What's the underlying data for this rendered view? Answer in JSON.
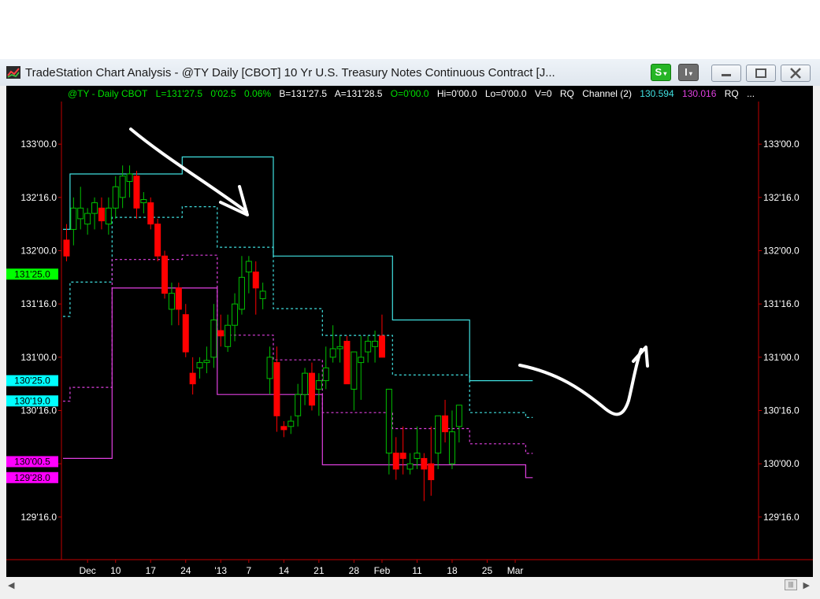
{
  "window": {
    "title": "TradeStation Chart Analysis - @TY Daily [CBOT] 10 Yr U.S. Treasury Notes Continuous Contract [J...",
    "s_button_label": "S",
    "i_button_label": "I"
  },
  "status": {
    "symbol": "@TY - Daily  CBOT",
    "last": "L=131'27.5",
    "change": "0'02.5",
    "pct": "0.06%",
    "bid": "B=131'27.5",
    "ask": "A=131'28.5",
    "open": "O=0'00.0",
    "high": "Hi=0'00.0",
    "low": "Lo=0'00.0",
    "volume": "V=0",
    "rq1": "RQ",
    "indicator": "Channel (2)",
    "ch_upper": "130.594",
    "ch_lower": "130.016",
    "rq2": "RQ",
    "more": "..."
  },
  "colors": {
    "background": "#000000",
    "up_candle": "#00c000",
    "down_candle": "#ff0000",
    "upper_channel": "#40e0e0",
    "lower_channel": "#e040e0",
    "axis": "#c00000",
    "last_price_marker": "#00ff00",
    "cyan_marker": "#00ffff",
    "magenta_marker": "#ff00ff"
  },
  "chart_data": {
    "type": "candlestick",
    "y_axis_labels": [
      "133'00.0",
      "132'16.0",
      "132'00.0",
      "131'16.0",
      "131'00.0",
      "130'16.0",
      "130'00.0",
      "129'16.0"
    ],
    "y_axis_values": [
      133.0,
      132.5,
      132.0,
      131.5,
      131.0,
      130.5,
      130.0,
      129.5
    ],
    "ylim": [
      129.1,
      133.4
    ],
    "x_axis_labels": [
      {
        "label": "Dec",
        "bar": 3.5
      },
      {
        "label": "10",
        "bar": 7.5
      },
      {
        "label": "17",
        "bar": 12.5
      },
      {
        "label": "24",
        "bar": 17.5
      },
      {
        "label": "'13",
        "bar": 22.5
      },
      {
        "label": "7",
        "bar": 26.5
      },
      {
        "label": "14",
        "bar": 31.5
      },
      {
        "label": "21",
        "bar": 36.5
      },
      {
        "label": "28",
        "bar": 41.5
      },
      {
        "label": "Feb",
        "bar": 45.5
      },
      {
        "label": "11",
        "bar": 50.5
      },
      {
        "label": "18",
        "bar": 55.5
      },
      {
        "label": "25",
        "bar": 60.5
      },
      {
        "label": "Mar",
        "bar": 64.5
      }
    ],
    "price_markers": [
      {
        "label": "131'25.0",
        "value": 131.78,
        "color": "#00ff00"
      },
      {
        "label": "130'25.0",
        "value": 130.78,
        "color": "#00ffff"
      },
      {
        "label": "130'19.0",
        "value": 130.59,
        "color": "#00ffff"
      },
      {
        "label": "130'00.5",
        "value": 130.02,
        "color": "#ff00ff"
      },
      {
        "label": "129'28.0",
        "value": 129.87,
        "color": "#ff00ff"
      }
    ],
    "candles": [
      [
        132.1,
        132.25,
        131.9,
        131.95
      ],
      [
        132.2,
        132.5,
        132.05,
        132.4
      ],
      [
        132.3,
        132.6,
        132.2,
        132.4
      ],
      [
        132.25,
        132.4,
        132.15,
        132.35
      ],
      [
        132.35,
        132.5,
        132.2,
        132.45
      ],
      [
        132.4,
        132.5,
        132.2,
        132.28
      ],
      [
        132.25,
        132.5,
        132.15,
        132.4
      ],
      [
        132.4,
        132.7,
        132.3,
        132.6
      ],
      [
        132.5,
        132.8,
        132.4,
        132.7
      ],
      [
        132.65,
        132.8,
        132.5,
        132.72
      ],
      [
        132.7,
        132.75,
        132.3,
        132.4
      ],
      [
        132.45,
        132.55,
        132.35,
        132.48
      ],
      [
        132.45,
        132.5,
        132.2,
        132.25
      ],
      [
        132.25,
        132.3,
        131.9,
        131.95
      ],
      [
        131.95,
        132.0,
        131.55,
        131.6
      ],
      [
        131.45,
        131.7,
        131.3,
        131.6
      ],
      [
        131.65,
        131.7,
        131.3,
        131.45
      ],
      [
        131.4,
        131.5,
        131.0,
        131.05
      ],
      [
        130.85,
        131.0,
        130.65,
        130.75
      ],
      [
        130.9,
        131.0,
        130.8,
        130.95
      ],
      [
        130.95,
        131.1,
        130.85,
        130.97
      ],
      [
        131.0,
        131.5,
        130.9,
        131.35
      ],
      [
        131.25,
        131.4,
        131.1,
        131.2
      ],
      [
        131.1,
        131.4,
        131.05,
        131.3
      ],
      [
        131.3,
        131.6,
        131.15,
        131.5
      ],
      [
        131.45,
        131.95,
        131.4,
        131.75
      ],
      [
        131.8,
        131.95,
        131.6,
        131.9
      ],
      [
        131.8,
        131.9,
        131.4,
        131.65
      ],
      [
        131.55,
        131.7,
        131.45,
        131.62
      ],
      [
        130.8,
        131.1,
        130.65,
        131.0
      ],
      [
        130.95,
        131.1,
        130.3,
        130.45
      ],
      [
        130.35,
        130.4,
        130.25,
        130.32
      ],
      [
        130.35,
        130.45,
        130.28,
        130.4
      ],
      [
        130.45,
        130.75,
        130.35,
        130.65
      ],
      [
        130.65,
        130.9,
        130.55,
        130.85
      ],
      [
        130.85,
        130.95,
        130.5,
        130.55
      ],
      [
        130.7,
        130.85,
        130.45,
        130.78
      ],
      [
        130.78,
        131.1,
        130.7,
        130.9
      ],
      [
        131.0,
        131.3,
        130.95,
        131.08
      ],
      [
        131.08,
        131.2,
        130.95,
        131.1
      ],
      [
        131.15,
        131.2,
        130.8,
        130.75
      ],
      [
        130.7,
        131.0,
        130.5,
        131.05
      ],
      [
        130.95,
        131.2,
        130.6,
        131.0
      ],
      [
        131.05,
        131.2,
        130.95,
        131.15
      ],
      [
        131.1,
        131.25,
        130.95,
        131.15
      ],
      [
        131.2,
        131.4,
        131.1,
        131.0
      ],
      [
        130.1,
        130.3,
        129.9,
        130.7
      ],
      [
        130.1,
        130.25,
        129.85,
        129.95
      ],
      [
        130.1,
        130.35,
        129.9,
        130.05
      ],
      [
        129.95,
        130.1,
        129.9,
        130.0
      ],
      [
        130.05,
        130.35,
        129.95,
        130.1
      ],
      [
        130.05,
        130.1,
        129.65,
        129.95
      ],
      [
        130.0,
        130.35,
        129.7,
        129.85
      ],
      [
        130.1,
        130.4,
        129.95,
        130.45
      ],
      [
        130.45,
        130.6,
        130.2,
        130.3
      ],
      [
        130.0,
        130.5,
        129.95,
        130.3
      ],
      [
        130.35,
        130.45,
        130.2,
        130.55
      ]
    ],
    "upper_channel": [
      132.2,
      132.72,
      132.72,
      132.72,
      132.72,
      132.72,
      132.72,
      132.72,
      132.72,
      132.72,
      132.72,
      132.72,
      132.72,
      132.72,
      132.72,
      132.72,
      132.72,
      132.88,
      132.88,
      132.88,
      132.88,
      132.88,
      132.88,
      132.88,
      132.88,
      132.88,
      132.88,
      132.88,
      132.88,
      132.88,
      131.95,
      131.95,
      131.95,
      131.95,
      131.95,
      131.95,
      131.95,
      131.95,
      131.95,
      131.95,
      131.95,
      131.95,
      131.95,
      131.95,
      131.95,
      131.95,
      131.95,
      131.35,
      131.35,
      131.35,
      131.35,
      131.35,
      131.35,
      131.35,
      131.35,
      131.35,
      131.35,
      131.35,
      130.78,
      130.78,
      130.78,
      130.78,
      130.78,
      130.78,
      130.78,
      130.78,
      130.78
    ],
    "lower_channel": [
      130.05,
      130.05,
      130.05,
      130.05,
      130.05,
      130.05,
      130.05,
      131.65,
      131.65,
      131.65,
      131.65,
      131.65,
      131.65,
      131.65,
      131.65,
      131.65,
      131.65,
      131.65,
      131.65,
      131.65,
      131.65,
      131.65,
      130.65,
      130.65,
      130.65,
      130.65,
      130.65,
      130.65,
      130.65,
      130.65,
      130.65,
      130.65,
      130.65,
      130.65,
      130.65,
      130.65,
      130.65,
      129.99,
      129.99,
      129.99,
      129.99,
      129.99,
      129.99,
      129.99,
      129.99,
      129.99,
      129.99,
      129.99,
      129.99,
      129.99,
      129.99,
      129.99,
      129.99,
      129.99,
      129.99,
      129.99,
      129.99,
      129.99,
      129.99,
      129.99,
      129.99,
      129.99,
      129.99,
      129.99,
      129.99,
      129.99,
      129.87
    ]
  }
}
